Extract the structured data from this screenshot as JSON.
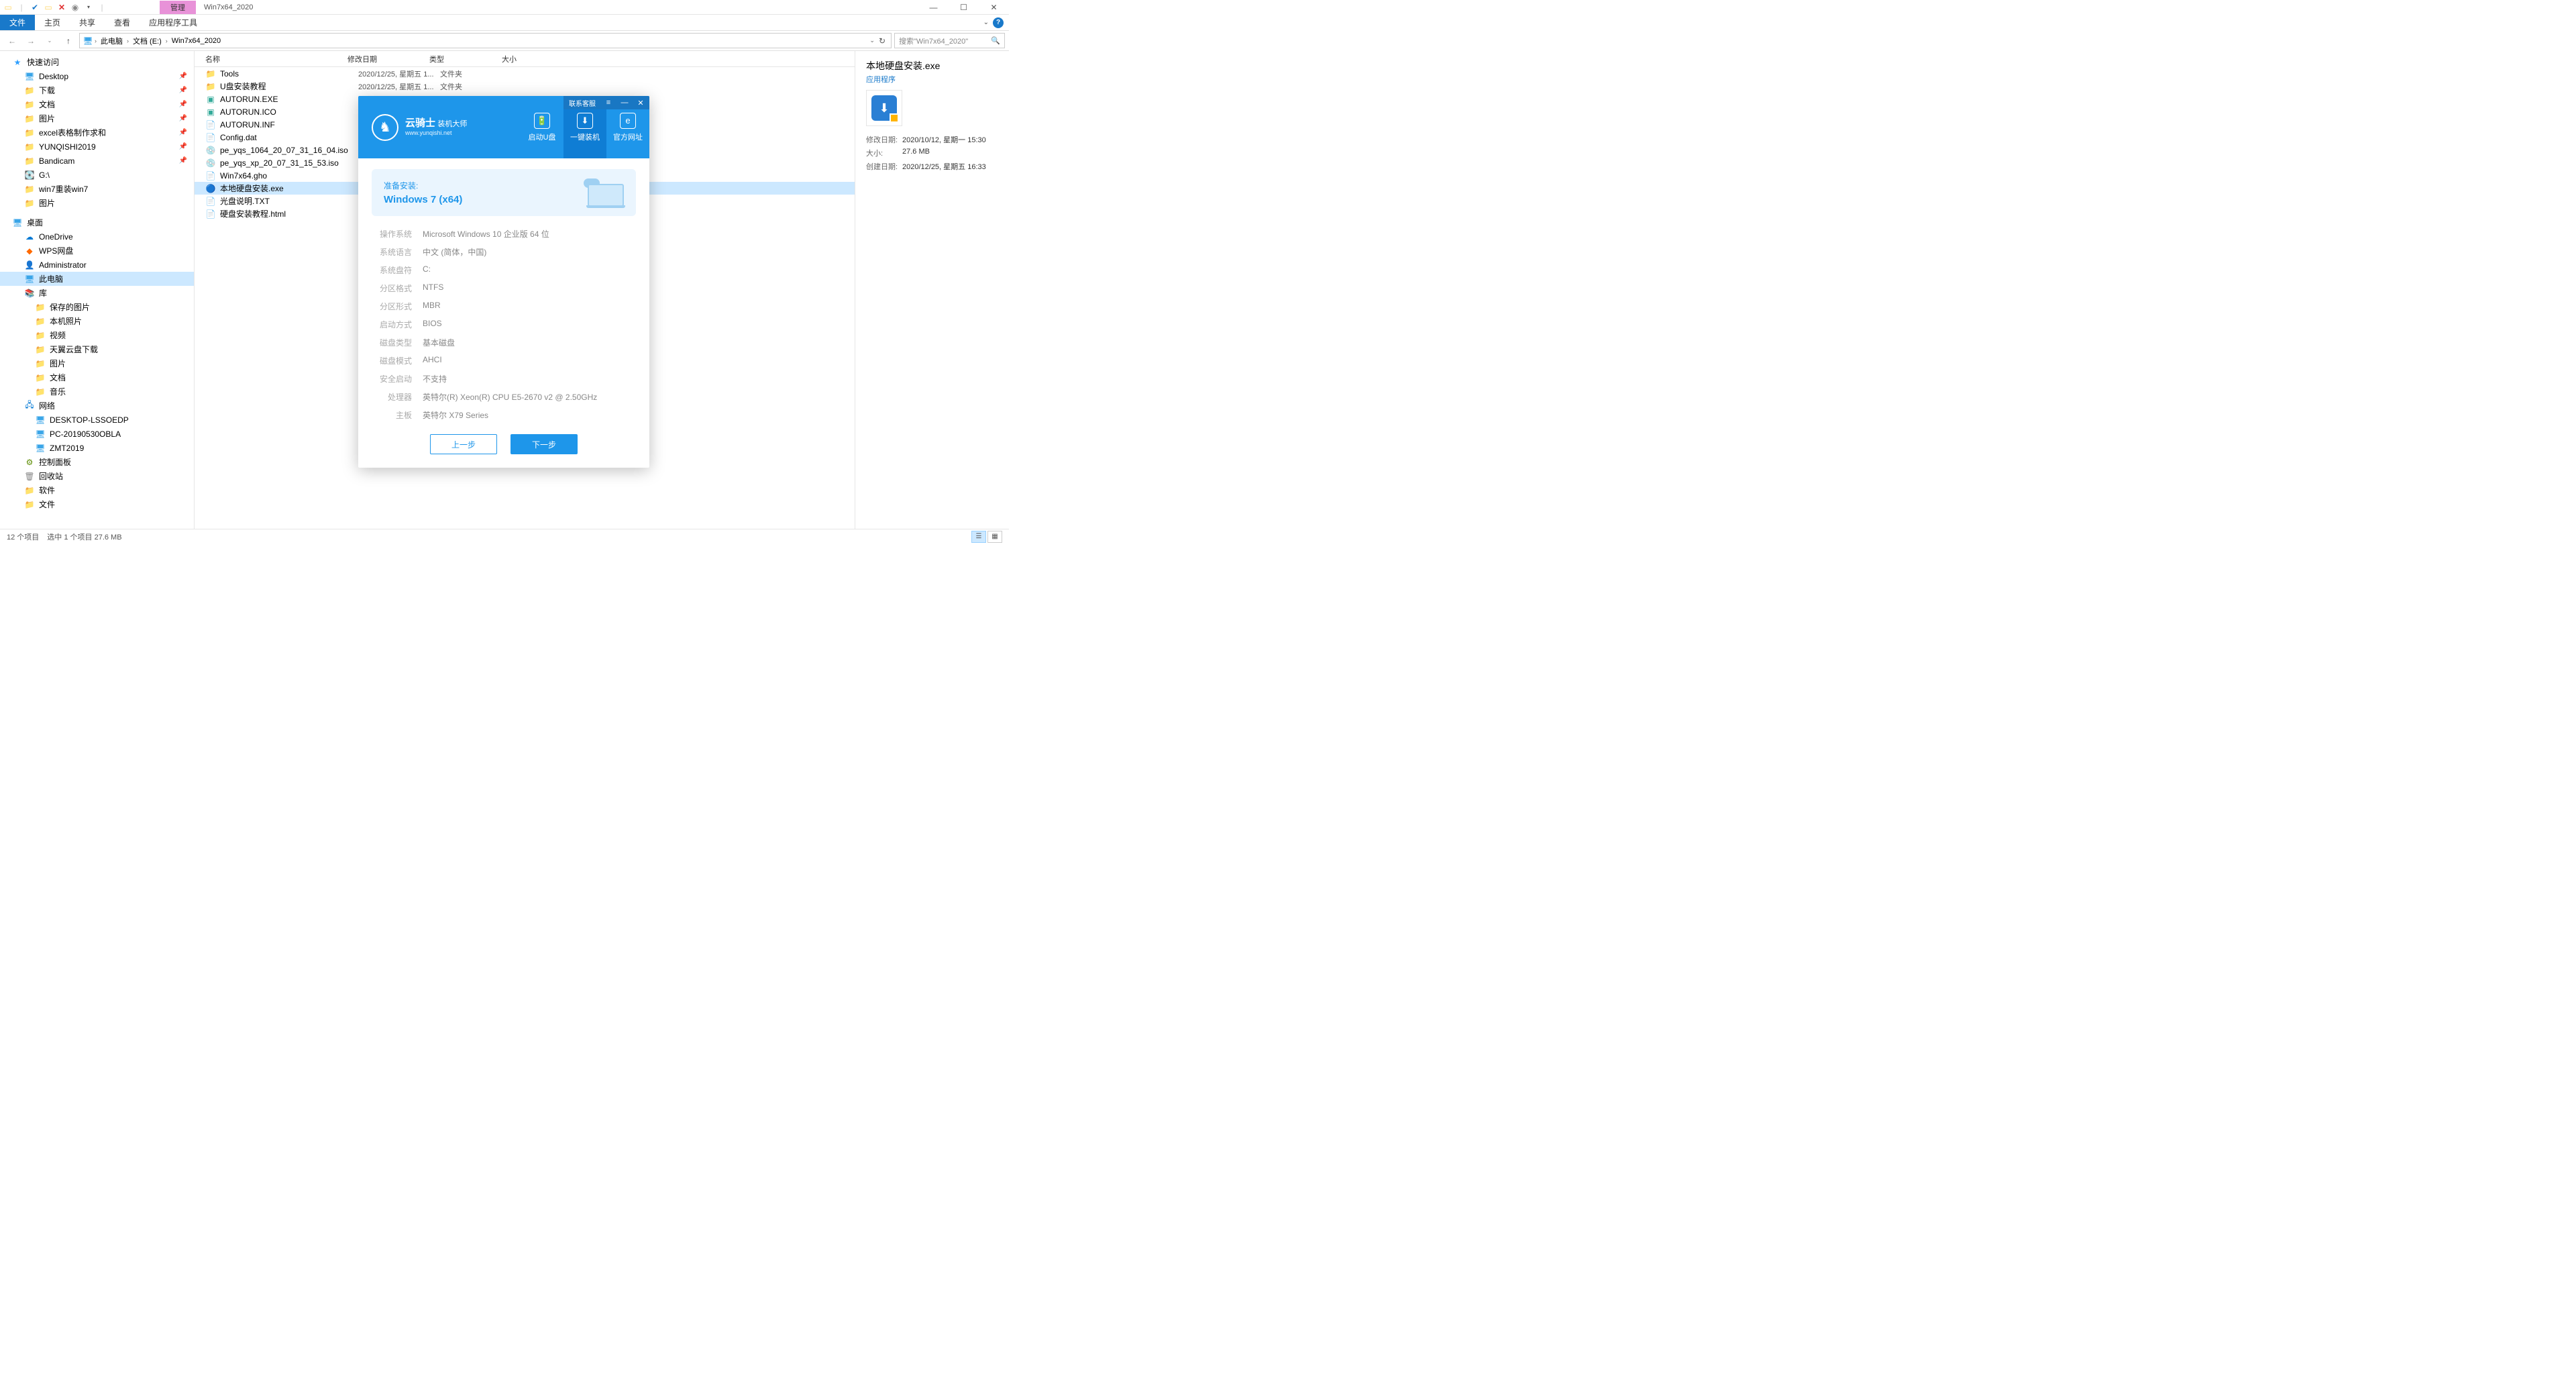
{
  "window": {
    "manage_tab": "管理",
    "title": "Win7x64_2020"
  },
  "ribbon": {
    "file": "文件",
    "tabs": [
      "主页",
      "共享",
      "查看",
      "应用程序工具"
    ]
  },
  "breadcrumb": {
    "items": [
      "此电脑",
      "文档 (E:)",
      "Win7x64_2020"
    ]
  },
  "search": {
    "placeholder": "搜索\"Win7x64_2020\""
  },
  "nav": {
    "quick_access": "快速访问",
    "quick_items": [
      {
        "label": "Desktop",
        "icon": "desktop",
        "pin": true
      },
      {
        "label": "下载",
        "icon": "folder",
        "pin": true
      },
      {
        "label": "文档",
        "icon": "folder",
        "pin": true
      },
      {
        "label": "图片",
        "icon": "folder",
        "pin": true
      },
      {
        "label": "excel表格制作求和",
        "icon": "folder",
        "pin": true
      },
      {
        "label": "YUNQISHI2019",
        "icon": "folder",
        "pin": true
      },
      {
        "label": "Bandicam",
        "icon": "folder",
        "pin": true
      },
      {
        "label": "G:\\",
        "icon": "drive",
        "pin": false
      },
      {
        "label": "win7重装win7",
        "icon": "folder",
        "pin": false
      },
      {
        "label": "图片",
        "icon": "folder",
        "pin": false
      }
    ],
    "desktop": "桌面",
    "desktop_items": [
      {
        "label": "OneDrive",
        "icon": "cloud"
      },
      {
        "label": "WPS网盘",
        "icon": "wps"
      },
      {
        "label": "Administrator",
        "icon": "admin"
      },
      {
        "label": "此电脑",
        "icon": "monitor",
        "selected": true
      },
      {
        "label": "库",
        "icon": "lib"
      }
    ],
    "lib_items": [
      {
        "label": "保存的图片"
      },
      {
        "label": "本机照片"
      },
      {
        "label": "视频"
      },
      {
        "label": "天翼云盘下载"
      },
      {
        "label": "图片"
      },
      {
        "label": "文档"
      },
      {
        "label": "音乐"
      }
    ],
    "network": "网络",
    "net_items": [
      {
        "label": "DESKTOP-LSSOEDP"
      },
      {
        "label": "PC-20190530OBLA"
      },
      {
        "label": "ZMT2019"
      }
    ],
    "control_panel": "控制面板",
    "recycle": "回收站",
    "software": "软件",
    "files": "文件"
  },
  "columns": {
    "name": "名称",
    "date": "修改日期",
    "type": "类型",
    "size": "大小"
  },
  "files": [
    {
      "name": "Tools",
      "date": "2020/12/25, 星期五 1...",
      "type": "文件夹",
      "icon": "folder"
    },
    {
      "name": "U盘安装教程",
      "date": "2020/12/25, 星期五 1...",
      "type": "文件夹",
      "icon": "folder"
    },
    {
      "name": "AUTORUN.EXE",
      "date": "",
      "type": "",
      "icon": "exe"
    },
    {
      "name": "AUTORUN.ICO",
      "date": "",
      "type": "",
      "icon": "ico"
    },
    {
      "name": "AUTORUN.INF",
      "date": "",
      "type": "",
      "icon": "inf"
    },
    {
      "name": "Config.dat",
      "date": "",
      "type": "",
      "icon": "dat"
    },
    {
      "name": "pe_yqs_1064_20_07_31_16_04.iso",
      "date": "",
      "type": "",
      "icon": "iso"
    },
    {
      "name": "pe_yqs_xp_20_07_31_15_53.iso",
      "date": "",
      "type": "",
      "icon": "iso"
    },
    {
      "name": "Win7x64.gho",
      "date": "",
      "type": "",
      "icon": "gho"
    },
    {
      "name": "本地硬盘安装.exe",
      "date": "",
      "type": "",
      "icon": "app",
      "selected": true
    },
    {
      "name": "光盘说明.TXT",
      "date": "",
      "type": "",
      "icon": "txt"
    },
    {
      "name": "硬盘安装教程.html",
      "date": "",
      "type": "",
      "icon": "html"
    }
  ],
  "details": {
    "title": "本地硬盘安装.exe",
    "subtitle": "应用程序",
    "rows": [
      {
        "label": "修改日期:",
        "value": "2020/10/12, 星期一 15:30"
      },
      {
        "label": "大小:",
        "value": "27.6 MB"
      },
      {
        "label": "创建日期:",
        "value": "2020/12/25, 星期五 16:33"
      }
    ]
  },
  "status": {
    "count": "12 个项目",
    "selected": "选中 1 个项目  27.6 MB"
  },
  "installer": {
    "contact": "联系客服",
    "logo_main": "云骑士",
    "logo_side": "装机大师",
    "logo_sub": "www.yunqishi.net",
    "tabs": [
      {
        "label": "启动U盘",
        "icon": "🔋"
      },
      {
        "label": "一键装机",
        "icon": "⬇",
        "active": true
      },
      {
        "label": "官方网址",
        "icon": "e"
      }
    ],
    "banner_label": "准备安装:",
    "banner_title": "Windows 7 (x64)",
    "info": [
      {
        "label": "操作系统",
        "value": "Microsoft Windows 10 企业版 64 位"
      },
      {
        "label": "系统语言",
        "value": "中文 (简体，中国)"
      },
      {
        "label": "系统盘符",
        "value": "C:"
      },
      {
        "label": "分区格式",
        "value": "NTFS"
      },
      {
        "label": "分区形式",
        "value": "MBR"
      },
      {
        "label": "启动方式",
        "value": "BIOS"
      },
      {
        "label": "磁盘类型",
        "value": "基本磁盘"
      },
      {
        "label": "磁盘模式",
        "value": "AHCI"
      },
      {
        "label": "安全启动",
        "value": "不支持"
      },
      {
        "label": "处理器",
        "value": "英特尔(R) Xeon(R) CPU E5-2670 v2 @ 2.50GHz"
      },
      {
        "label": "主板",
        "value": "英特尔 X79 Series"
      }
    ],
    "btn_prev": "上一步",
    "btn_next": "下一步"
  }
}
